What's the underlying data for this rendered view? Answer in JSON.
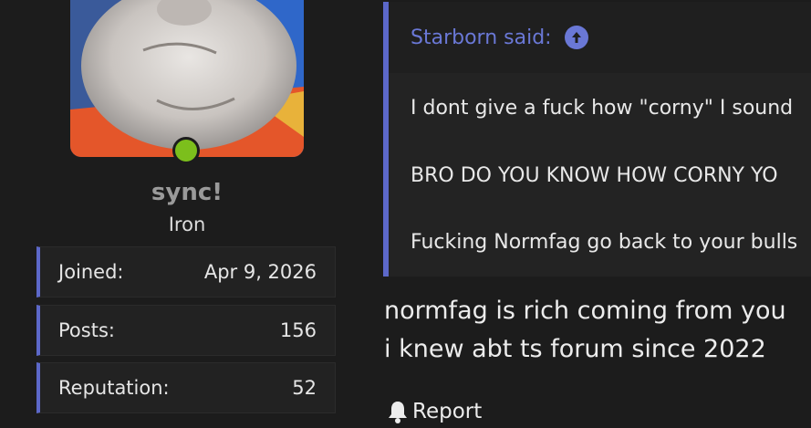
{
  "user": {
    "username": "sync!",
    "rank": "Iron",
    "stats": [
      {
        "label": "Joined:",
        "value": "Apr 9, 2026"
      },
      {
        "label": "Posts:",
        "value": "156"
      },
      {
        "label": "Reputation:",
        "value": "52"
      }
    ],
    "online_color": "#7cbf1c"
  },
  "quote": {
    "author": "Starborn said:",
    "lines": [
      "I dont give a fuck how \"corny\" I sound",
      "BRO DO YOU KNOW HOW CORNY YO",
      "Fucking Normfag go back to your bulls"
    ]
  },
  "message": {
    "lines": [
      "normfag is rich coming from you",
      "i knew abt ts forum since 2022"
    ]
  },
  "actions": {
    "report_label": "Report"
  },
  "colors": {
    "accent": "#5c68c9",
    "background": "#1c1c1c"
  }
}
